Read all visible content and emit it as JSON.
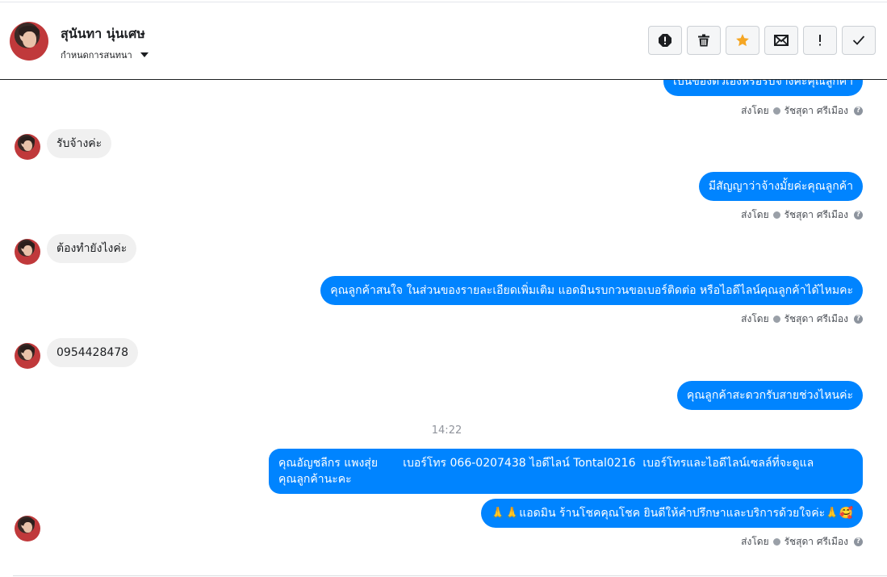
{
  "contact": {
    "name": "สุนันทา นุ่นเศษ",
    "assign_label": "กำหนดการสนทนา"
  },
  "actions": [
    {
      "icon": "report-spam-icon",
      "tooltip": ""
    },
    {
      "icon": "trash-icon"
    },
    {
      "icon": "star-icon",
      "color": "#f5a623"
    },
    {
      "icon": "envelope-icon"
    },
    {
      "icon": "exclamation-icon"
    },
    {
      "icon": "checkmark-icon"
    }
  ],
  "sent_by": {
    "prefix": "ส่งโดย",
    "agent": "รัชสุดา ศรีเมือง"
  },
  "messages": [
    {
      "dir": "out",
      "text": "เป็นของตัวเองหรือรับจ้างค่ะคุณลูกค้า"
    },
    {
      "dir": "in",
      "text": "รับจ้างค่ะ"
    },
    {
      "dir": "out",
      "text": "มีสัญญาว่าจ้างมั้ยค่ะคุณลูกค้า"
    },
    {
      "dir": "in",
      "text": "ต้องทำยังไงค่ะ"
    },
    {
      "dir": "out",
      "text": "คุณลูกค้าสนใจ ในส่วนของรายละเอียดเพิ่มเติม แอดมินรบกวนขอเบอร์ติดต่อ หรือไอดีไลน์คุณลูกค้าได้ไหมคะ"
    },
    {
      "dir": "in",
      "text": "0954428478"
    },
    {
      "dir": "out",
      "text": "คุณลูกค้าสะดวกรับสายช่วงไหนค่ะ"
    },
    {
      "dir": "time",
      "text": "14:22"
    },
    {
      "dir": "out",
      "line1": "คุณอัญชลีกร แพงสุ่ย       เบอร์โทร 066-0207438 ไอดีไลน์ Tontal0216  เบอร์โทรและไอดีไลน์เซลล์ที่จะดูแล",
      "line2": "คุณลูกค้านะคะ"
    },
    {
      "dir": "out",
      "text": "🙏🙏แอดมิน ร้านโชคคุณโชค ยินดีให้คำปรึกษาและบริการด้วยใจค่ะ🙏🥰"
    }
  ],
  "colors": {
    "outgoing_bubble": "#0084ff",
    "incoming_bubble": "#f0f0f0",
    "star": "#f5a623"
  }
}
